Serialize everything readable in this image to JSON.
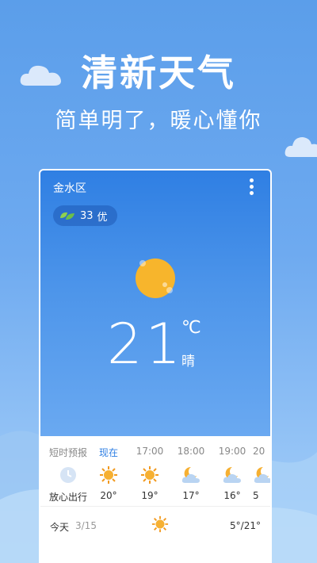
{
  "promo": {
    "headline": "清新天气",
    "subline": "简单明了，暖心懂你"
  },
  "card": {
    "location": "金水区",
    "aqi": {
      "value": "33",
      "level": "优"
    },
    "current": {
      "temp": "21",
      "unit": "℃",
      "condition": "晴"
    },
    "forecast": {
      "label": "短时预报",
      "label_sub": "放心出行",
      "hours": [
        {
          "time": "现在",
          "icon": "sun-icon",
          "temp": "20°"
        },
        {
          "time": "17:00",
          "icon": "sun-icon",
          "temp": "19°"
        },
        {
          "time": "18:00",
          "icon": "moon-cloud-icon",
          "temp": "17°"
        },
        {
          "time": "19:00",
          "icon": "moon-cloud-icon",
          "temp": "16°"
        },
        {
          "time": "20",
          "icon": "moon-cloud-icon",
          "temp": "5"
        }
      ]
    },
    "today": {
      "label": "今天",
      "date": "3/15",
      "icon": "sun-icon",
      "range": "5°/21°"
    }
  },
  "colors": {
    "accent": "#2f7fe3",
    "sun": "#f7b52c"
  }
}
